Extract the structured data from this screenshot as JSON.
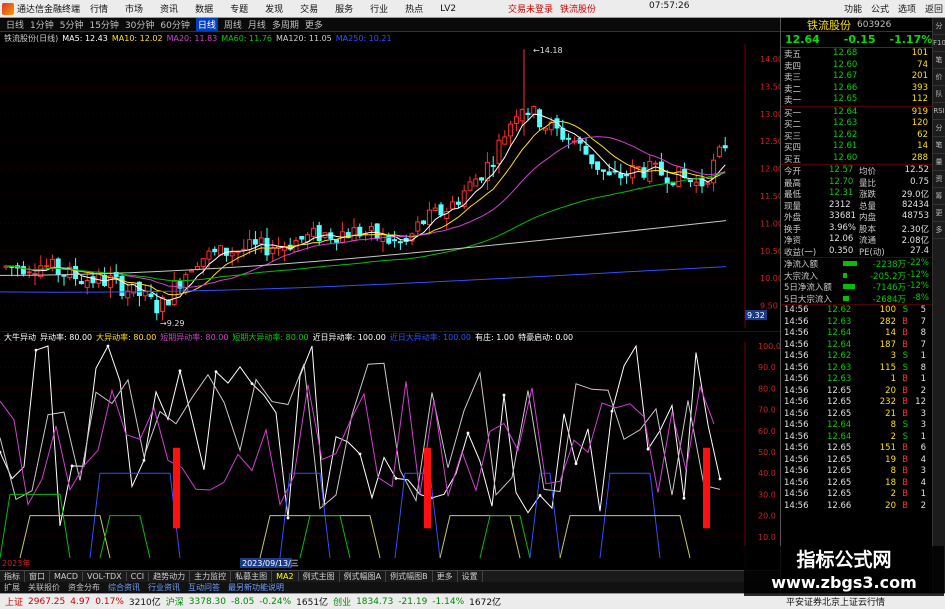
{
  "menubar": {
    "app_title": "通达信金融终端",
    "items": [
      "行情",
      "市场",
      "资讯",
      "数据",
      "专题",
      "发现",
      "交易",
      "服务",
      "行业",
      "热点",
      "LV2"
    ],
    "center_links": [
      "交易未登录",
      "铁流股份"
    ],
    "time": "07:57:26",
    "right_items": [
      "功能",
      "公式",
      "选项",
      "返回"
    ]
  },
  "periods": [
    "日线",
    "1分钟",
    "5分钟",
    "15分钟",
    "30分钟",
    "60分钟",
    "日线",
    "周线",
    "月线",
    "多周期",
    "更多"
  ],
  "active_period_index": 6,
  "ma_legend": [
    {
      "text": "铁流股份(日线)",
      "color": "#d0d0d0"
    },
    {
      "text": "MA5: 12.43",
      "color": "#ffffff"
    },
    {
      "text": "MA10: 12.02",
      "color": "#ffe000"
    },
    {
      "text": "MA20: 11.83",
      "color": "#d040d0"
    },
    {
      "text": "MA60: 11.76",
      "color": "#00d000"
    },
    {
      "text": "MA120: 11.05",
      "color": "#d0d0d0"
    },
    {
      "text": "MA250: 10.21",
      "color": "#3050ff"
    }
  ],
  "kline": {
    "price_ticks": [
      "14.00",
      "13.50",
      "13.00",
      "12.50",
      "12.00",
      "11.50",
      "11.00",
      "10.50",
      "10.00",
      "9.50"
    ],
    "high_label": "14.18",
    "low_label": "9.29",
    "cursor_label": "9.32"
  },
  "indicator": {
    "legend": [
      {
        "text": "大牛异动",
        "color": "#ffffff"
      },
      {
        "text": "异动率: 80.00",
        "color": "#ffffff"
      },
      {
        "text": "大异动率: 80.00",
        "color": "#ffe000"
      },
      {
        "text": "短期异动率: 80.00",
        "color": "#d040d0"
      },
      {
        "text": "短期大异动率: 80.00",
        "color": "#00d000"
      },
      {
        "text": "近日异动率: 100.00",
        "color": "#ffffff"
      },
      {
        "text": "近日大异动率: 100.00",
        "color": "#3050ff"
      },
      {
        "text": "有庄: 1.00",
        "color": "#ffffff"
      },
      {
        "text": "特豪启动: 0.00",
        "color": "#ffffff"
      }
    ],
    "axis_ticks": [
      "100.0",
      "90.0",
      "80.0",
      "70.0",
      "60.0",
      "50.0",
      "40.0",
      "30.0",
      "20.0",
      "10.0"
    ],
    "date_label": "2023/09/13/三",
    "start_label": "2023年"
  },
  "tabs": [
    "指标",
    "窗口",
    "MACD",
    "VOL-TDX",
    "CCI",
    "趋势动力",
    "主力监控",
    "私募主图",
    "MA2",
    "例式主图",
    "例式幅图A",
    "例式幅图B",
    "更多",
    "设置"
  ],
  "tabs2": [
    "扩展",
    "关联报价",
    "资金分布",
    "综合资讯",
    "行业资讯",
    "互动问答",
    "最另新功能说明"
  ],
  "statusbar": {
    "sh_label": "上证",
    "sh_value": "2967.25",
    "sh_change": "4.97",
    "sh_pct": "0.17%",
    "sh_amount": "3210亿",
    "sz_label": "沪深",
    "sz_value": "3378.30",
    "sz_change": "-8.05",
    "sz_pct": "-0.24%",
    "sz_amount": "1651亿",
    "cy_label": "创业",
    "cy_value": "1834.73",
    "cy_change": "-21.19",
    "cy_pct": "-1.14%",
    "cy_amount": "1672亿",
    "right_text": "平安证券北京上证云行情"
  },
  "panel": {
    "name": "铁流股份",
    "code": "603926",
    "price": "12.64",
    "change": "-0.15",
    "pct": "-1.17%",
    "asks": [
      {
        "label": "卖五",
        "price": "12.68",
        "vol": "101"
      },
      {
        "label": "卖四",
        "price": "12.60",
        "vol": "74"
      },
      {
        "label": "卖三",
        "price": "12.67",
        "vol": "201"
      },
      {
        "label": "卖二",
        "price": "12.66",
        "vol": "393"
      },
      {
        "label": "卖一",
        "price": "12.65",
        "vol": "112"
      }
    ],
    "bids": [
      {
        "label": "买一",
        "price": "12.64",
        "vol": "919"
      },
      {
        "label": "买二",
        "price": "12.63",
        "vol": "120"
      },
      {
        "label": "买三",
        "price": "12.62",
        "vol": "62"
      },
      {
        "label": "买四",
        "price": "12.61",
        "vol": "14"
      },
      {
        "label": "买五",
        "price": "12.60",
        "vol": "288"
      }
    ],
    "stats": [
      {
        "l1": "今开",
        "v1": "12.57",
        "l2": "均价",
        "v2": "12.52"
      },
      {
        "l1": "最高",
        "v1": "12.70",
        "l2": "量比",
        "v2": "0.75"
      },
      {
        "l1": "最低",
        "v1": "12.31",
        "l2": "涨跌",
        "v2": "29.0亿"
      },
      {
        "l1": "现量",
        "v1": "2312",
        "l2": "总量",
        "v2": "82434"
      },
      {
        "l1": "外盘",
        "v1": "33681",
        "l2": "内盘",
        "v2": "48753"
      },
      {
        "l1": "换手",
        "v1": "3.96%",
        "l2": "股本",
        "v2": "2.30亿"
      },
      {
        "l1": "净资",
        "v1": "12.06",
        "l2": "流通",
        "v2": "2.08亿"
      },
      {
        "l1": "收益(一)",
        "v1": "0.350",
        "l2": "PE(动)",
        "v2": "27.4"
      }
    ],
    "flows": [
      {
        "label": "净流入额",
        "value": "-2238万",
        "pct": "-22%"
      },
      {
        "label": "大宗流入",
        "value": "-205.2万",
        "pct": "-12%"
      },
      {
        "label": "5日净流入额",
        "value": "-7146万",
        "pct": "-12%"
      },
      {
        "label": "5日大宗流入",
        "value": "-2684万",
        "pct": "-8%"
      }
    ],
    "ticks": [
      {
        "time": "14:56",
        "price": "12.62",
        "vol": "100",
        "dir": "S",
        "n": "5"
      },
      {
        "time": "14:56",
        "price": "12.63",
        "vol": "282",
        "dir": "B",
        "n": "7"
      },
      {
        "time": "14:56",
        "price": "12.64",
        "vol": "14",
        "dir": "B",
        "n": "8"
      },
      {
        "time": "14:56",
        "price": "12.64",
        "vol": "187",
        "dir": "B",
        "n": "7"
      },
      {
        "time": "14:56",
        "price": "12.62",
        "vol": "3",
        "dir": "S",
        "n": "1"
      },
      {
        "time": "14:56",
        "price": "12.63",
        "vol": "115",
        "dir": "S",
        "n": "8"
      },
      {
        "time": "14:56",
        "price": "12.63",
        "vol": "1",
        "dir": "B",
        "n": "1"
      },
      {
        "time": "14:56",
        "price": "12.65",
        "vol": "20",
        "dir": "B",
        "n": "2"
      },
      {
        "time": "14:56",
        "price": "12.65",
        "vol": "232",
        "dir": "B",
        "n": "12"
      },
      {
        "time": "14:56",
        "price": "12.65",
        "vol": "21",
        "dir": "B",
        "n": "3"
      },
      {
        "time": "14:56",
        "price": "12.64",
        "vol": "8",
        "dir": "S",
        "n": "3"
      },
      {
        "time": "14:56",
        "price": "12.64",
        "vol": "2",
        "dir": "S",
        "n": "1"
      },
      {
        "time": "14:56",
        "price": "12.65",
        "vol": "151",
        "dir": "B",
        "n": "6"
      },
      {
        "time": "14:56",
        "price": "12.65",
        "vol": "19",
        "dir": "B",
        "n": "4"
      },
      {
        "time": "14:56",
        "price": "12.65",
        "vol": "8",
        "dir": "B",
        "n": "3"
      },
      {
        "time": "14:56",
        "price": "12.65",
        "vol": "18",
        "dir": "B",
        "n": "4"
      },
      {
        "time": "14:56",
        "price": "12.65",
        "vol": "2",
        "dir": "B",
        "n": "1"
      },
      {
        "time": "14:56",
        "price": "12.66",
        "vol": "20",
        "dir": "B",
        "n": "2"
      }
    ]
  },
  "sidestrip": [
    "分",
    "F10",
    "笔",
    "价",
    "队",
    "RSI",
    "分",
    "笔",
    "量",
    "资",
    "筹",
    "更",
    "多"
  ],
  "watermark": {
    "line1": "指标公式网",
    "line2": "www.zbgs3.com"
  }
}
